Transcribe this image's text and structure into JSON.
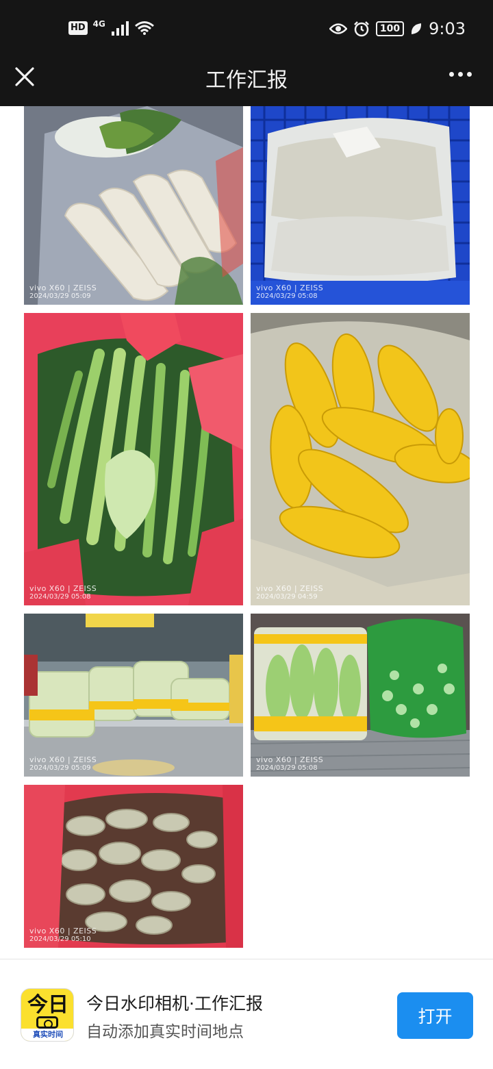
{
  "status_bar": {
    "hd": "HD",
    "network": "4G",
    "battery": "100",
    "time": "9:03",
    "icons": [
      "signal-icon",
      "wifi-icon",
      "eye-icon",
      "alarm-icon",
      "battery-icon",
      "leaf-icon"
    ]
  },
  "nav": {
    "title": "工作汇报",
    "close_icon": "close-icon",
    "more_icon": "more-icon"
  },
  "photos": [
    {
      "subject": "white radishes in plastic bags",
      "camera": "vivo X60 | ZEISS",
      "date": "2024/03/29 05:09"
    },
    {
      "subject": "bagged produce in blue crate",
      "camera": "vivo X60 | ZEISS",
      "date": "2024/03/29 05:08"
    },
    {
      "subject": "celery in red bag",
      "camera": "vivo X60 | ZEISS",
      "date": "2024/03/29 05:08"
    },
    {
      "subject": "corn cobs in plastic bag",
      "camera": "vivo X60 | ZEISS",
      "date": "2024/03/29 04:59"
    },
    {
      "subject": "cabbages on steel counter",
      "camera": "vivo X60 | ZEISS",
      "date": "2024/03/29 05:09"
    },
    {
      "subject": "bok choy bundles",
      "camera": "vivo X60 | ZEISS",
      "date": "2024/03/29 05:08"
    },
    {
      "subject": "ginger in red bag",
      "camera": "vivo X60 | ZEISS",
      "date": "2024/03/29 05:10"
    }
  ],
  "bottom_bar": {
    "app_icon_text": "今日",
    "app_icon_strip": "真实时间",
    "app_name": "今日水印相机·工作汇报",
    "app_desc": "自动添加真实时间地点",
    "open_button": "打开"
  },
  "colors": {
    "header_bg": "#151515",
    "button_blue": "#1b8ef0",
    "app_icon_yellow": "#fbe02e"
  }
}
